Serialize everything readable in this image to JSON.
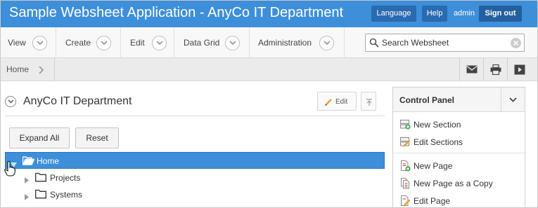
{
  "app": {
    "title": "Sample Websheet Application - AnyCo IT Department",
    "language_label": "Language",
    "help_label": "Help",
    "user": "admin",
    "signout_label": "Sign out"
  },
  "menu": {
    "items": [
      {
        "label": "View"
      },
      {
        "label": "Create"
      },
      {
        "label": "Edit"
      },
      {
        "label": "Data Grid"
      },
      {
        "label": "Administration"
      }
    ],
    "search_value": "Search Websheet"
  },
  "breadcrumb": {
    "items": [
      {
        "label": "Home"
      }
    ]
  },
  "toolbar": {
    "icons": [
      "email-icon",
      "print-icon",
      "present-icon"
    ]
  },
  "region": {
    "title": "AnyCo IT Department",
    "edit_label": "Edit",
    "expand_all_label": "Expand All",
    "reset_label": "Reset"
  },
  "tree": {
    "nodes": [
      {
        "label": "Home",
        "selected": true,
        "expanded": true
      },
      {
        "label": "Projects",
        "selected": false,
        "expanded": false
      },
      {
        "label": "Systems",
        "selected": false,
        "expanded": false
      }
    ]
  },
  "control_panel": {
    "title": "Control Panel",
    "items": [
      {
        "label": "New Section"
      },
      {
        "label": "Edit Sections"
      },
      {
        "label": "New Page"
      },
      {
        "label": "New Page as a Copy"
      },
      {
        "label": "Edit Page"
      }
    ]
  },
  "colors": {
    "header": "#3d8fd9",
    "header_button": "#2a6bb0",
    "selected_row": "#3d8fd9"
  }
}
